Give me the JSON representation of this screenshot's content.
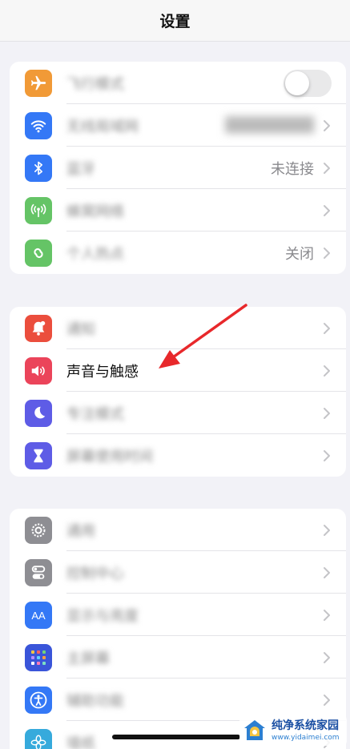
{
  "navbar": {
    "title": "设置"
  },
  "group1": [
    {
      "label": "飞行模式",
      "icon": "airplane-icon",
      "color": "#f19a37",
      "accessory": "toggle",
      "toggle_on": false
    },
    {
      "label": "无线局域网",
      "icon": "wifi-icon",
      "color": "#3478f6",
      "value": "",
      "accessory": "chevron"
    },
    {
      "label": "蓝牙",
      "icon": "bluetooth-icon",
      "color": "#3478f6",
      "value": "未连接",
      "accessory": "chevron"
    },
    {
      "label": "蜂窝网络",
      "icon": "cellular-icon",
      "color": "#65c466",
      "value": "",
      "accessory": "chevron"
    },
    {
      "label": "个人热点",
      "icon": "hotspot-icon",
      "color": "#65c466",
      "value": "关闭",
      "accessory": "chevron"
    }
  ],
  "group2": [
    {
      "label": "通知",
      "icon": "notification-bell-icon",
      "color": "#eb4e3d",
      "accessory": "chevron"
    },
    {
      "label": "声音与触感",
      "icon": "speaker-icon",
      "color": "#eb445a",
      "accessory": "chevron"
    },
    {
      "label": "专注模式",
      "icon": "moon-icon",
      "color": "#5e5ce6",
      "accessory": "chevron"
    },
    {
      "label": "屏幕使用时间",
      "icon": "hourglass-icon",
      "color": "#5e5ce6",
      "accessory": "chevron"
    }
  ],
  "group3": [
    {
      "label": "通用",
      "icon": "gear-icon",
      "color": "#8e8e93",
      "accessory": "chevron"
    },
    {
      "label": "控制中心",
      "icon": "control-center-icon",
      "color": "#8e8e93",
      "accessory": "chevron"
    },
    {
      "label": "显示与亮度",
      "icon": "display-brightness-icon",
      "color": "#3478f6",
      "accessory": "chevron"
    },
    {
      "label": "主屏幕",
      "icon": "home-screen-icon",
      "color": "#3a55d9",
      "accessory": "chevron"
    },
    {
      "label": "辅助功能",
      "icon": "accessibility-icon",
      "color": "#3478f6",
      "accessory": "chevron"
    },
    {
      "label": "墙纸",
      "icon": "wallpaper-icon",
      "color": "#36aadc",
      "accessory": "chevron"
    }
  ],
  "watermark": {
    "line1": "纯净系统家园",
    "line2": "www.yidaimei.com"
  },
  "colors": {
    "background": "#f2f2f7",
    "annotation_arrow": "#e8282b"
  }
}
